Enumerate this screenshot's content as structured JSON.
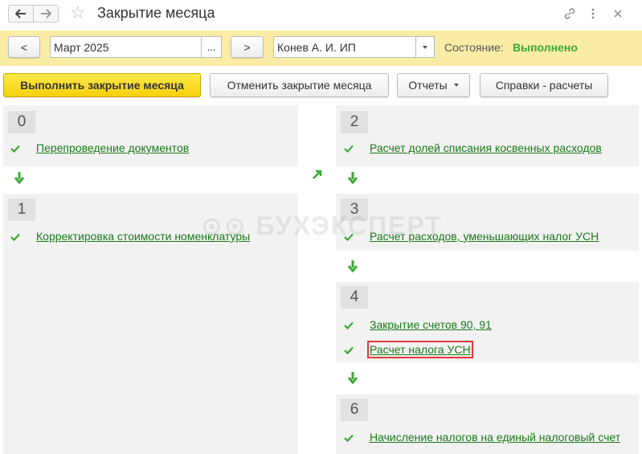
{
  "window": {
    "title": "Закрытие месяца",
    "icons": [
      "back-arrow-icon",
      "forward-arrow-icon",
      "star-icon",
      "link-icon",
      "more-icon",
      "close-icon"
    ]
  },
  "toolbar": {
    "prev_label": "<",
    "period": "Март 2025",
    "period_select_label": "...",
    "next_label": ">",
    "organization": "Конев А. И. ИП",
    "state_label": "Состояние:",
    "state_value": "Выполнено"
  },
  "actions": {
    "run_close": "Выполнить закрытие месяца",
    "cancel_close": "Отменить закрытие месяца",
    "reports": "Отчеты",
    "references": "Справки - расчеты"
  },
  "watermark": "БУХЭКСПЕРТ",
  "steps": [
    {
      "num": "0",
      "items": [
        "Перепроведение документов"
      ]
    },
    {
      "num": "1",
      "items": [
        "Корректировка стоимости номенклатуры"
      ]
    },
    {
      "num": "2",
      "items": [
        "Расчет долей списания косвенных расходов"
      ]
    },
    {
      "num": "3",
      "items": [
        "Расчет расходов, уменьшающих налог УСН"
      ]
    },
    {
      "num": "4",
      "items": [
        "Закрытие счетов 90, 91",
        "Расчет налога УСН"
      ]
    },
    {
      "num": "6",
      "items": [
        "Начисление налогов на единый налоговый счет"
      ]
    }
  ],
  "colors": {
    "toolbar_bg": "#fbeca6",
    "state_ok": "#3aaa35",
    "link": "#1a7a1a",
    "highlight": "#e03a3a",
    "primary_button": "#f5d10c"
  }
}
